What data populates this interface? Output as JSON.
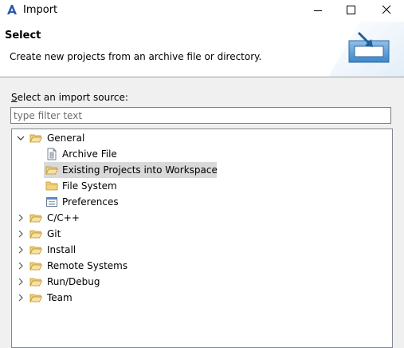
{
  "window": {
    "title": "Import",
    "icon": "app-logo-icon",
    "buttons": [
      "minimize-icon",
      "maximize-icon",
      "close-icon"
    ]
  },
  "banner": {
    "title": "Select",
    "description": "Create new projects from an archive file or directory.",
    "icon": "import-tray-icon"
  },
  "source": {
    "label_prefix": "S",
    "label_rest": "elect an import source:",
    "filter_placeholder": "type filter text",
    "filter_value": ""
  },
  "tree": {
    "general": {
      "label": "General",
      "expanded": true,
      "children": [
        {
          "label": "Archive File",
          "icon": "archive-file-icon"
        },
        {
          "label": "Existing Projects into Workspace",
          "icon": "open-folder-icon",
          "selected": true
        },
        {
          "label": "File System",
          "icon": "folder-icon"
        },
        {
          "label": "Preferences",
          "icon": "preferences-icon"
        }
      ]
    },
    "categories": [
      {
        "label": "C/C++"
      },
      {
        "label": "Git"
      },
      {
        "label": "Install"
      },
      {
        "label": "Remote Systems"
      },
      {
        "label": "Run/Debug"
      },
      {
        "label": "Team"
      }
    ]
  },
  "colors": {
    "selection": "#d9d9d9",
    "folder": "#e8b84a",
    "accent": "#1e73be"
  }
}
